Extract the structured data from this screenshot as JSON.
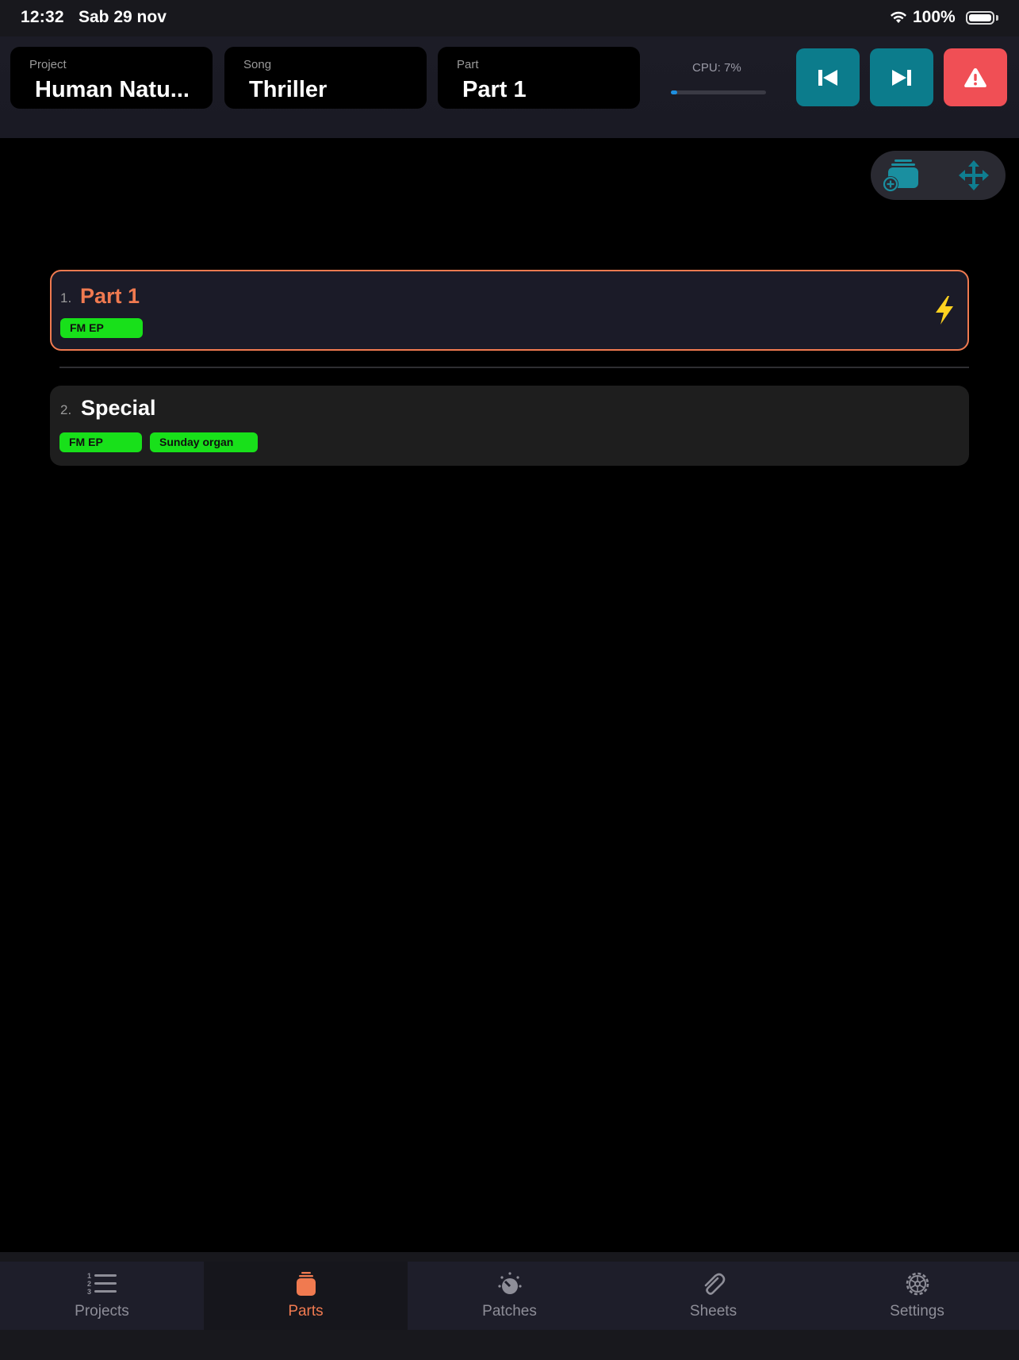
{
  "status_bar": {
    "time": "12:32",
    "date": "Sab 29 nov",
    "battery": "100%"
  },
  "header": {
    "project": {
      "label": "Project",
      "value": "Human Natu..."
    },
    "song": {
      "label": "Song",
      "value": "Thriller"
    },
    "part": {
      "label": "Part",
      "value": "Part 1"
    },
    "cpu": {
      "label": "CPU: 7%",
      "percent": 7
    },
    "buttons": {
      "previous": "skip-back-icon",
      "next": "skip-forward-icon",
      "panic": "warning-icon"
    }
  },
  "toolbar": {
    "add": "add-part-icon",
    "move": "move-arrows-icon"
  },
  "parts": [
    {
      "number": "1.",
      "name": "Part 1",
      "active": true,
      "patches": [
        "FM EP"
      ],
      "trigger_icon": "lightning-icon"
    },
    {
      "number": "2.",
      "name": "Special",
      "active": false,
      "patches": [
        "FM EP",
        "Sunday organ"
      ]
    }
  ],
  "tabs": [
    {
      "label": "Projects",
      "icon": "numbered-list-icon"
    },
    {
      "label": "Parts",
      "icon": "parts-stack-icon",
      "selected": true
    },
    {
      "label": "Patches",
      "icon": "knob-icon"
    },
    {
      "label": "Sheets",
      "icon": "paperclip-icon"
    },
    {
      "label": "Settings",
      "icon": "gear-icon"
    }
  ],
  "colors": {
    "accent": "#f07a50",
    "teal": "#0c7c8c",
    "danger": "#f04f55",
    "tag": "#18e01a",
    "bolt": "#ffd21f"
  }
}
